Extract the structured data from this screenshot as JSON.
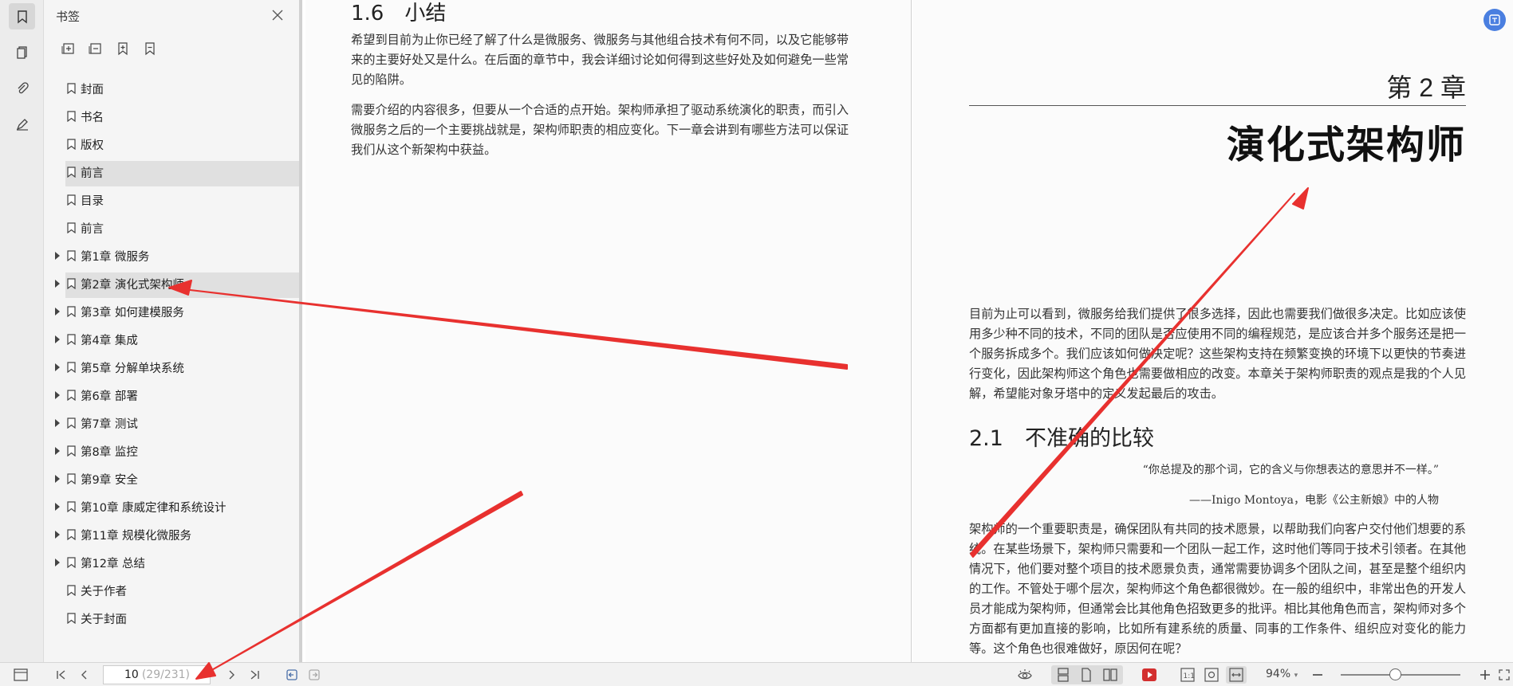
{
  "bookmark_panel": {
    "title": "书签",
    "items": [
      {
        "label": "封面",
        "expandable": false,
        "selected": false
      },
      {
        "label": "书名",
        "expandable": false,
        "selected": false
      },
      {
        "label": "版权",
        "expandable": false,
        "selected": false
      },
      {
        "label": "前言",
        "expandable": false,
        "selected": true
      },
      {
        "label": "目录",
        "expandable": false,
        "selected": false
      },
      {
        "label": "前言",
        "expandable": false,
        "selected": false
      },
      {
        "label": "第1章 微服务",
        "expandable": true,
        "selected": false
      },
      {
        "label": "第2章 演化式架构师",
        "expandable": true,
        "selected": true
      },
      {
        "label": "第3章 如何建模服务",
        "expandable": true,
        "selected": false
      },
      {
        "label": "第4章 集成",
        "expandable": true,
        "selected": false
      },
      {
        "label": "第5章 分解单块系统",
        "expandable": true,
        "selected": false
      },
      {
        "label": "第6章 部署",
        "expandable": true,
        "selected": false
      },
      {
        "label": "第7章 测试",
        "expandable": true,
        "selected": false
      },
      {
        "label": "第8章 监控",
        "expandable": true,
        "selected": false
      },
      {
        "label": "第9章 安全",
        "expandable": true,
        "selected": false
      },
      {
        "label": "第10章 康威定律和系统设计",
        "expandable": true,
        "selected": false
      },
      {
        "label": "第11章 规模化微服务",
        "expandable": true,
        "selected": false
      },
      {
        "label": "第12章 总结",
        "expandable": true,
        "selected": false
      },
      {
        "label": "关于作者",
        "expandable": false,
        "selected": false
      },
      {
        "label": "关于封面",
        "expandable": false,
        "selected": false
      }
    ]
  },
  "left_page": {
    "heading": "1.6　小结",
    "para1": "希望到目前为止你已经了解了什么是微服务、微服务与其他组合技术有何不同，以及它能够带来的主要好处又是什么。在后面的章节中，我会详细讨论如何得到这些好处及如何避免一些常见的陷阱。",
    "para2": "需要介绍的内容很多，但要从一个合适的点开始。架构师承担了驱动系统演化的职责，而引入微服务之后的一个主要挑战就是，架构师职责的相应变化。下一章会讲到有哪些方法可以保证我们从这个新架构中获益。"
  },
  "right_page": {
    "chapter_number": "第 2 章",
    "chapter_title": "演化式架构师",
    "intro": "目前为止可以看到，微服务给我们提供了很多选择，因此也需要我们做很多决定。比如应该使用多少种不同的技术，不同的团队是否应使用不同的编程规范，是应该合并多个服务还是把一个服务拆成多个。我们应该如何做决定呢？这些架构支持在频繁变换的环境下以更快的节奏进行变化，因此架构师这个角色也需要做相应的改变。本章关于架构师职责的观点是我的个人见解，希望能对象牙塔中的定义发起最后的攻击。",
    "section_heading": "2.1　不准确的比较",
    "quote": "“你总提及的那个词，它的含义与你想表达的意思并不一样。”",
    "quote_source": "——Inigo Montoya，电影《公主新娘》中的人物",
    "body": "架构师的一个重要职责是，确保团队有共同的技术愿景，以帮助我们向客户交付他们想要的系统。在某些场景下，架构师只需要和一个团队一起工作，这时他们等同于技术引领者。在其他情况下，他们要对整个项目的技术愿景负责，通常需要协调多个团队之间，甚至是整个组织内的工作。不管处于哪个层次，架构师这个角色都很微妙。在一般的组织中，非常出色的开发人员才能成为架构师，但通常会比其他角色招致更多的批评。相比其他角色而言，架构师对多个方面都有更加直接的影响，比如所有建系统的质量、同事的工作条件、组织应对变化的能力等。这个角色也很难做好，原因何在呢？"
  },
  "status_bar": {
    "page_current": "10",
    "page_total": "(29/231)",
    "zoom": "94%"
  },
  "colors": {
    "annotation_arrow": "#e8312f",
    "accent": "#4a7fe0"
  }
}
